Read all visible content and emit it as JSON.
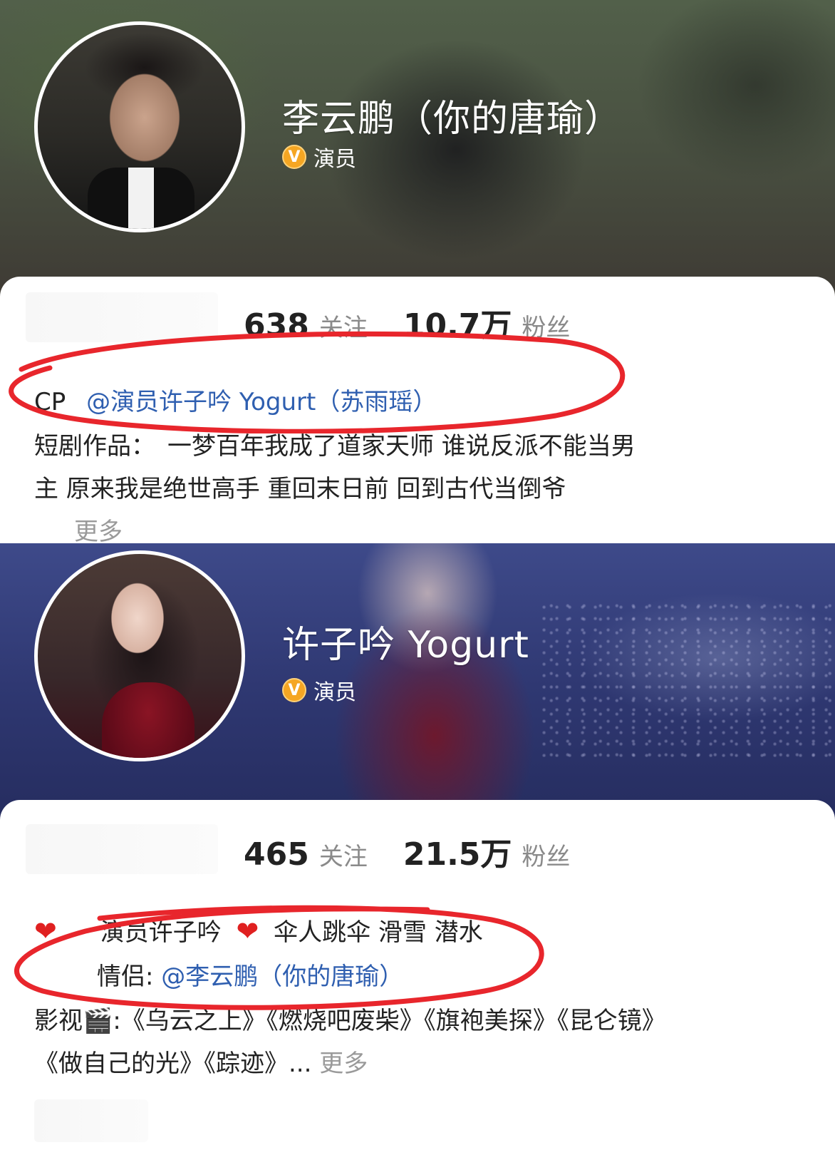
{
  "profiles": [
    {
      "name": "李云鹏（你的唐瑜）",
      "verify_label": "演员",
      "stats": {
        "following_count": "638",
        "following_label": "关注",
        "followers_count": "10.7万",
        "followers_label": "粉丝"
      },
      "bio": {
        "cp_prefix": "CP",
        "cp_mention": "@演员许子吟 Yogurt（苏雨瑶）",
        "works_line1": "短剧作品：　一梦百年我成了道家天师  谁说反派不能当男",
        "works_line2": "主  原来我是绝世高手  重回末日前  回到古代当倒爷",
        "more": "更多"
      }
    },
    {
      "name": "许子吟 Yogurt",
      "verify_label": "演员",
      "stats": {
        "following_count": "465",
        "following_label": "关注",
        "followers_count": "21.5万",
        "followers_label": "粉丝"
      },
      "bio": {
        "line1_text": "演员许子吟",
        "line1_tail": "伞人跳伞 滑雪 潜水",
        "couple_label": "情侣: ",
        "couple_mention": "@李云鹏（你的唐瑜）",
        "works_line1": "影视🎬:《乌云之上》《燃烧吧废柴》《旗袍美探》《昆仑镜》",
        "works_line2": "《做自己的光》《踪迹》... ",
        "more": "更多"
      }
    }
  ],
  "colors": {
    "mention": "#2f5fb0",
    "badge": "#f5a623",
    "annotation_red": "#e8262c"
  }
}
